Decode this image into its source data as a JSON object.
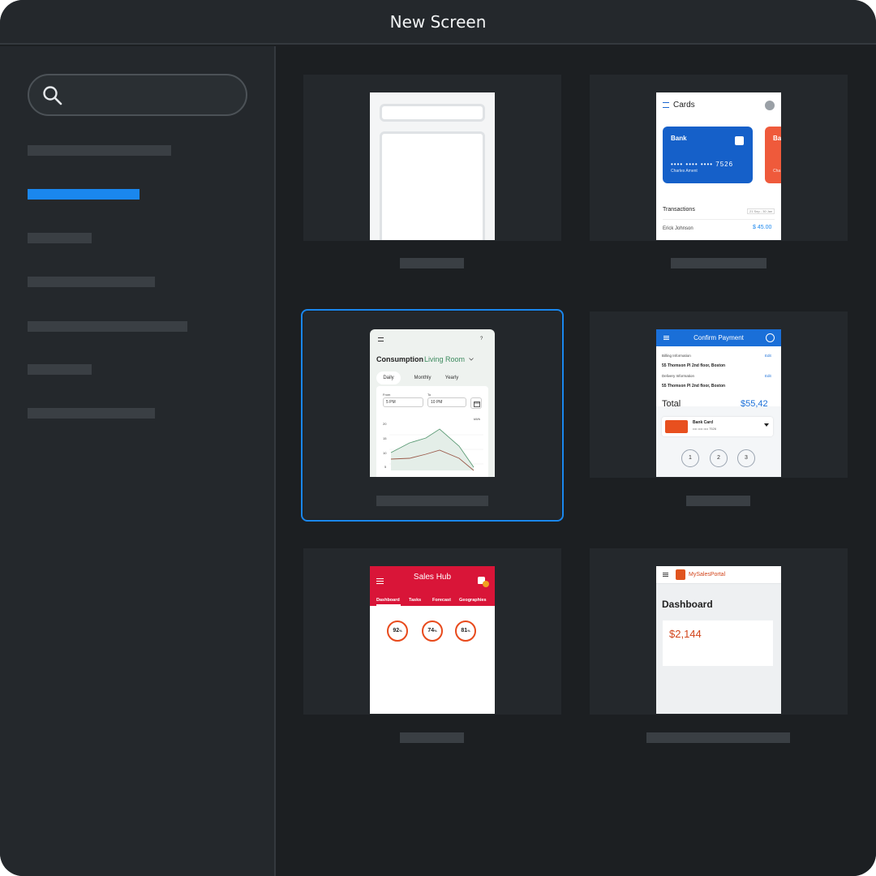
{
  "window": {
    "title": "New Screen"
  },
  "search": {
    "value": "",
    "placeholder": ""
  },
  "thumbnails": {
    "cards": {
      "title": "Cards",
      "card1_bank": "Bank",
      "card1_number": "•••• •••• •••• 7526",
      "card1_owner": "Charles Ament",
      "card2_bank": "Ba",
      "card2_owner": "Cha",
      "transactions_label": "Transactions",
      "date_range": "21 Sep - 30 Jan",
      "transaction_name": "Erick Johnson",
      "transaction_amount": "$ 45.00"
    },
    "consumption": {
      "help": "?",
      "title": "Consumption",
      "room": "Living Room",
      "tabs": [
        "Daily",
        "Monthly",
        "Yearly"
      ],
      "from_label": "From",
      "from_value": "5 PM",
      "to_label": "To",
      "to_value": "10 PM",
      "unit": "kWh",
      "y_ticks": [
        "20",
        "15",
        "10",
        "5"
      ]
    },
    "payment": {
      "title": "Confirm Payment",
      "billing_label": "Billing Information",
      "billing_edit": "Edit",
      "billing_address": "55 Thomson Pl 2nd floor, Boston",
      "delivery_label": "Delivery Information",
      "delivery_edit": "Edit",
      "delivery_address": "55 Thomson Pl 2nd floor, Boston",
      "total_label": "Total",
      "total_amount": "$55,42",
      "card_name": "Bank Card",
      "card_number": "•••• •••• •••• 7526",
      "steps": [
        "1",
        "2",
        "3"
      ]
    },
    "sales_hub": {
      "title": "Sales Hub",
      "badge": "1",
      "tabs": [
        "Dashboard",
        "Tasks",
        "Forecast",
        "Geographies"
      ],
      "rings": [
        "92",
        "74",
        "81"
      ],
      "ring_unit": "%"
    },
    "sales_portal": {
      "app_name": "MySalesPortal",
      "title": "Dashboard",
      "kpi_value": "$2,144"
    }
  },
  "colors": {
    "accent": "#1a87ee",
    "background": "#1c1f22",
    "panel": "#24282c",
    "placeholder_bar": "#3a3f44"
  }
}
